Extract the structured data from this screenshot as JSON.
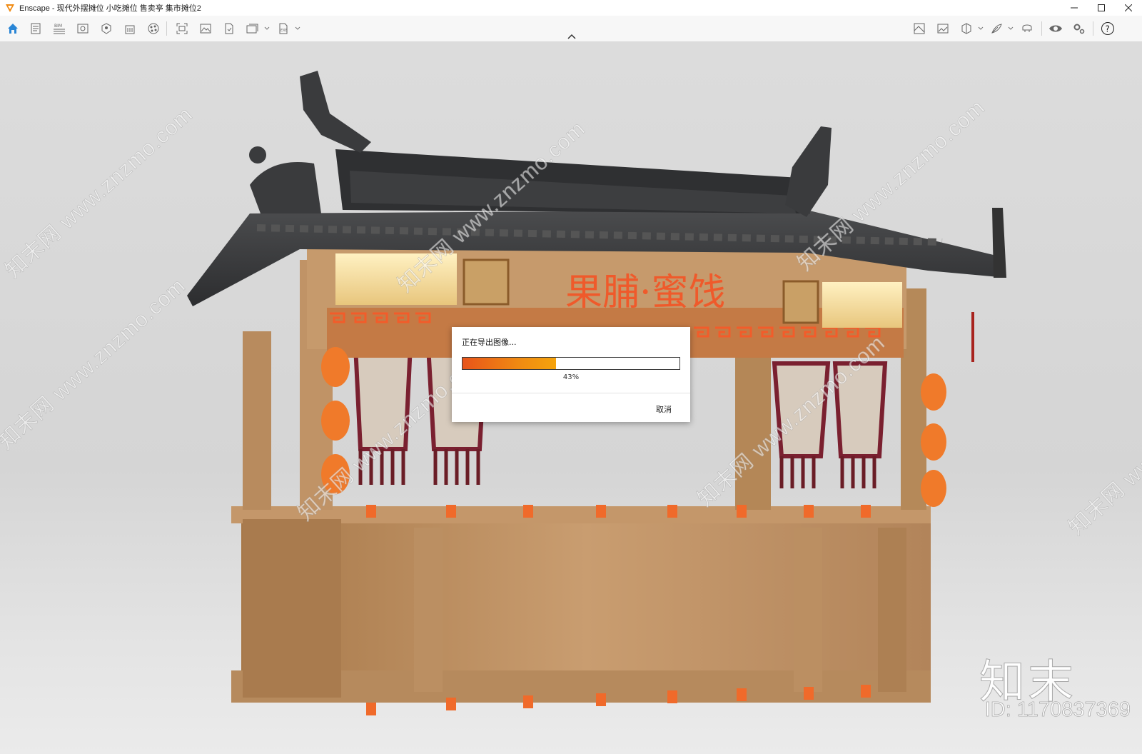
{
  "window": {
    "title": "Enscape - 现代外摆摊位 小吃摊位 售卖亭 集市摊位2",
    "controls": [
      "minimize-icon",
      "maximize-icon",
      "close-icon"
    ]
  },
  "toolbar": {
    "left_icons": [
      "home-icon",
      "document-icon",
      "bim-icon",
      "view-icon",
      "asset-icon",
      "building-icon",
      "material-icon",
      "screenshot-icon",
      "image-icon",
      "file-export-icon",
      "batch-render-icon",
      "exe-export-icon"
    ],
    "right_icons": [
      "map-icon",
      "gallery-icon",
      "cube-icon",
      "feather-icon",
      "vr-headset-icon",
      "eye-icon",
      "settings-icon",
      "help-icon"
    ]
  },
  "scene": {
    "signboard": "果脯·蜜饯"
  },
  "dialog": {
    "title": "正在导出图像...",
    "progress": 0.43,
    "progress_label": "43%",
    "cancel_label": "取消"
  },
  "watermarks": {
    "diagonal": "知末网 www.znzmo.com",
    "brand": "知末",
    "id": "ID: 1170837369"
  },
  "colors": {
    "accent": "#f08a12",
    "progress_start": "#e8541a",
    "roof": "#3a3b3c",
    "wood": "#b98a5c",
    "lantern": "#f07a2a"
  }
}
